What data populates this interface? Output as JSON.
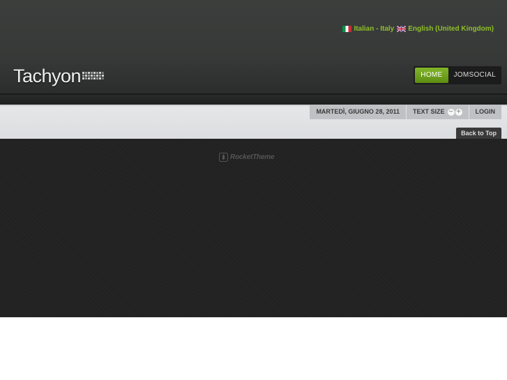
{
  "languages": [
    {
      "label": "Italian - Italy",
      "flag": "flag-italy-icon"
    },
    {
      "label": "English (United Kingdom)",
      "flag": "flag-uk-icon"
    }
  ],
  "logo": {
    "text": "Tachyon"
  },
  "nav": {
    "items": [
      {
        "label": "HOME",
        "active": true
      },
      {
        "label": "JOMSOCIAL",
        "active": false
      }
    ]
  },
  "toolbar": {
    "date": "MARTEDÌ, GIUGNO 28, 2011",
    "text_size_label": "TEXT SIZE",
    "decrease_symbol": "−",
    "increase_symbol": "+",
    "login_label": "LOGIN"
  },
  "back_to_top": "Back to Top",
  "footer": {
    "brand": "RocketTheme"
  },
  "colors": {
    "accent_green": "#82b52a",
    "lang_link": "#8fbf2a",
    "header_bg": "#373938",
    "footer_bg": "#222222"
  }
}
